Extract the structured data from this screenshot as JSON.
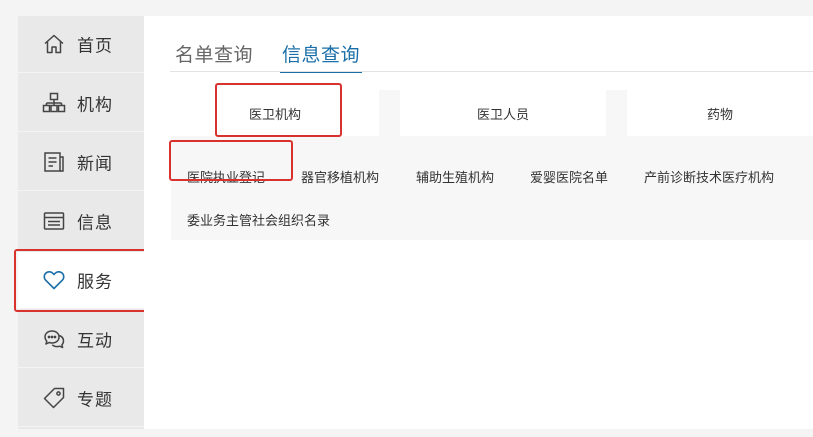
{
  "sidebar": {
    "items": [
      {
        "label": "首页",
        "icon": "home-icon"
      },
      {
        "label": "机构",
        "icon": "organization-icon"
      },
      {
        "label": "新闻",
        "icon": "news-icon"
      },
      {
        "label": "信息",
        "icon": "info-icon"
      },
      {
        "label": "服务",
        "icon": "heart-icon",
        "active": true
      },
      {
        "label": "互动",
        "icon": "chat-icon"
      },
      {
        "label": "专题",
        "icon": "tag-icon"
      }
    ]
  },
  "main": {
    "tabs": [
      {
        "label": "名单查询"
      },
      {
        "label": "信息查询",
        "active": true
      }
    ],
    "categories": [
      {
        "label": "医卫机构"
      },
      {
        "label": "医卫人员"
      },
      {
        "label": "药物"
      }
    ],
    "links": [
      {
        "label": "医院执业登记"
      },
      {
        "label": "器官移植机构"
      },
      {
        "label": "辅助生殖机构"
      },
      {
        "label": "爱婴医院名单"
      },
      {
        "label": "产前诊断技术医疗机构"
      },
      {
        "label": "委业务主管社会组织名录"
      }
    ]
  },
  "colors": {
    "accent": "#1a6fa8",
    "highlight": "#d9322e",
    "sidebar_bg": "#e9e9e9"
  }
}
